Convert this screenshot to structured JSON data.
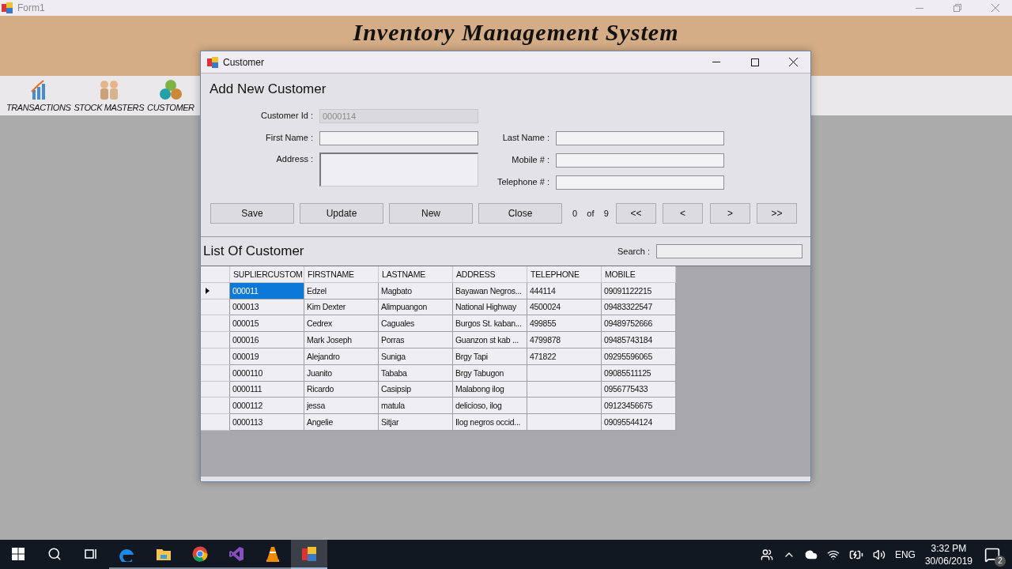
{
  "main_window": {
    "title": "Form1",
    "banner_title": "Inventory Management System",
    "toolbar": [
      {
        "kind": "chart",
        "label": "TRANSACTIONS"
      },
      {
        "kind": "workers",
        "label": "STOCK MASTERS"
      },
      {
        "kind": "people",
        "label": "CUSTOMER"
      }
    ]
  },
  "dialog": {
    "title": "Customer",
    "heading": "Add New Customer",
    "fields": [
      {
        "kind": "text",
        "label": "Customer Id :",
        "value": "0000114",
        "disabled": true
      },
      {
        "kind": "text",
        "label": "First Name :",
        "disabled": false
      },
      {
        "kind": "text",
        "label": "Last Name :",
        "disabled": false
      },
      {
        "kind": "multiline",
        "label": "Address :",
        "disabled": false
      },
      {
        "kind": "text",
        "label": "Mobile # :",
        "disabled": false
      },
      {
        "kind": "text",
        "label": "Telephone # :",
        "disabled": false
      }
    ],
    "buttons": [
      "Save",
      "Update",
      "New",
      "Close"
    ],
    "record": {
      "current": "0",
      "of": "of",
      "total": "9"
    },
    "nav_buttons": [
      "<<",
      "<",
      ">",
      ">>"
    ],
    "list": {
      "title": "List Of Customer",
      "search_label": "Search :",
      "columns": [
        "SUPLIERCUSTOM",
        "FIRSTNAME",
        "LASTNAME",
        "ADDRESS",
        "TELEPHONE",
        "MOBILE"
      ],
      "rows": [
        {
          "selected": true,
          "cells": [
            "000011",
            "Edzel",
            "Magbato",
            "Bayawan Negros...",
            "444114",
            "09091122215"
          ]
        },
        {
          "selected": false,
          "cells": [
            "000013",
            "Kim Dexter",
            "Alimpuangon",
            "National Highway",
            "4500024",
            "09483322547"
          ]
        },
        {
          "selected": false,
          "cells": [
            "000015",
            "Cedrex",
            "Caguales",
            "Burgos St. kaban...",
            "499855",
            "09489752666"
          ]
        },
        {
          "selected": false,
          "cells": [
            "000016",
            "Mark Joseph",
            "Porras",
            "Guanzon st kab ...",
            "4799878",
            "09485743184"
          ]
        },
        {
          "selected": false,
          "cells": [
            "000019",
            "Alejandro",
            "Suniga",
            "Brgy Tapi",
            "471822",
            "09295596065"
          ]
        },
        {
          "selected": false,
          "cells": [
            "0000110",
            "Juanito",
            "Tababa",
            "Brgy Tabugon",
            "",
            "09085511125"
          ]
        },
        {
          "selected": false,
          "cells": [
            "0000111",
            "Ricardo",
            "Casipsip",
            "Malabong ilog",
            "",
            "0956775433"
          ]
        },
        {
          "selected": false,
          "cells": [
            "0000112",
            "jessa",
            "matula",
            "delicioso, ilog",
            "",
            "09123456675"
          ]
        },
        {
          "selected": false,
          "cells": [
            "0000113",
            "Angelie",
            "Sitjar",
            "Ilog negros occid...",
            "",
            "09095544124"
          ]
        }
      ]
    }
  },
  "taskbar": {
    "apps": [
      {
        "kind": "start",
        "running": false,
        "active": false
      },
      {
        "kind": "search",
        "running": false,
        "active": false
      },
      {
        "kind": "task-view",
        "running": false,
        "active": false
      },
      {
        "kind": "edge",
        "running": true,
        "active": false
      },
      {
        "kind": "explorer",
        "running": true,
        "active": false
      },
      {
        "kind": "chrome",
        "running": true,
        "active": false
      },
      {
        "kind": "visual-studio",
        "running": true,
        "active": false
      },
      {
        "kind": "vlc",
        "running": true,
        "active": false
      },
      {
        "kind": "app",
        "running": true,
        "active": true
      }
    ],
    "language": "ENG",
    "time": "3:32 PM",
    "date": "30/06/2019",
    "notification_count": "2"
  }
}
